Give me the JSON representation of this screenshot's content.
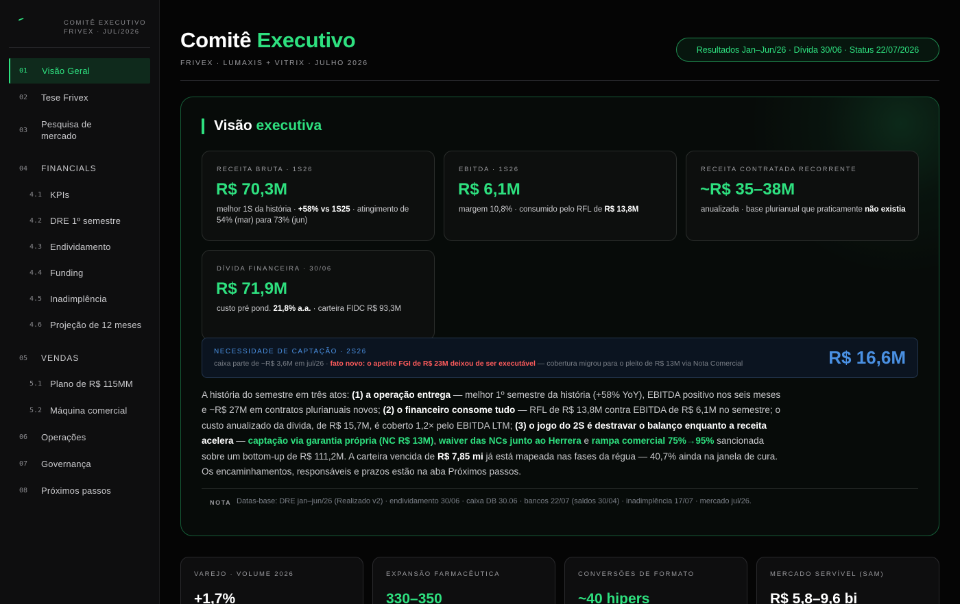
{
  "sidebar": {
    "brand_line1": "COMITÊ EXECUTIVO",
    "brand_line2": "FRIVEX · JUL/2026",
    "items": [
      {
        "num": "01",
        "label": "Visão Geral"
      },
      {
        "num": "02",
        "label": "Tese Frivex"
      },
      {
        "num": "03",
        "label": "Pesquisa de mercado"
      },
      {
        "num": "04",
        "label": "FINANCIALS"
      },
      {
        "num": "4.1",
        "label": "KPIs"
      },
      {
        "num": "4.2",
        "label": "DRE 1º semestre"
      },
      {
        "num": "4.3",
        "label": "Endividamento"
      },
      {
        "num": "4.4",
        "label": "Funding"
      },
      {
        "num": "4.5",
        "label": "Inadimplência"
      },
      {
        "num": "4.6",
        "label": "Projeção de 12 meses"
      },
      {
        "num": "05",
        "label": "VENDAS"
      },
      {
        "num": "5.1",
        "label": "Plano de R$ 115MM"
      },
      {
        "num": "5.2",
        "label": "Máquina comercial"
      },
      {
        "num": "06",
        "label": "Operações"
      },
      {
        "num": "07",
        "label": "Governança"
      },
      {
        "num": "08",
        "label": "Próximos passos"
      }
    ]
  },
  "header": {
    "title_main": "Comitê",
    "title_accent": "Executivo",
    "subtitle": "FRIVEX · LUMAXIS + VITRIX · JULHO 2026",
    "pill": "Resultados Jan–Jun/26 · Dívida 30/06 · Status 22/07/2026"
  },
  "overview": {
    "title_main": "Visão",
    "title_accent": "executiva",
    "kpis": [
      {
        "label": "RECEITA BRUTA · 1S26",
        "value": "R$ 70,3M",
        "desc_a": "melhor 1S da história · ",
        "desc_b": "+58% vs 1S25",
        "desc_c": " · atingimento de 54% (mar) para 73% (jun)"
      },
      {
        "label": "EBITDA · 1S26",
        "value": "R$ 6,1M",
        "desc_a": "margem 10,8% · consumido pelo RFL de ",
        "desc_b": "R$ 13,8M",
        "desc_c": ""
      },
      {
        "label": "RECEITA CONTRATADA RECORRENTE",
        "value": "~R$ 35–38M",
        "desc_a": "anualizada · base plurianual que praticamente ",
        "desc_b": "não existia",
        "desc_c": ""
      },
      {
        "label": "DÍVIDA FINANCEIRA · 30/06",
        "value": "R$ 71,9M",
        "desc_a": "custo pré pond. ",
        "desc_b": "21,8% a.a.",
        "desc_c": " · carteira FIDC R$ 93,3M"
      }
    ],
    "need": {
      "label": "NECESSIDADE DE CAPTAÇÃO · 2S26",
      "desc_a": "caixa parte de −R$ 3,6M em jul/26 · ",
      "desc_warn": "fato novo: o apetite FGI de R$ 23M deixou de ser executável",
      "desc_b": " — cobertura migrou para o pleito de R$ 13M via Nota Comercial",
      "value": "R$ 16,6M"
    },
    "paragraph": {
      "p1": "A história do semestre em três atos: ",
      "b1": "(1) a operação entrega",
      "p2": " — melhor 1º semestre da história (+58% YoY), EBITDA positivo nos seis meses e ~R$ 27M em contratos plurianuais novos; ",
      "b2": "(2) o financeiro consome tudo",
      "p3": " — RFL de R$ 13,8M contra EBITDA de R$ 6,1M no semestre; o custo anualizado da dívida, de R$ 15,7M, é coberto 1,2× pelo EBITDA LTM; ",
      "b3": "(3) o jogo do 2S é destravar o balanço enquanto a receita acelera",
      "p4": " — ",
      "g1": "captação via garantia própria (NC R$ 13M)",
      "p5": ", ",
      "g2": "waiver das NCs junto ao Herrera",
      "p6": " e ",
      "g3": "rampa comercial 75%→95%",
      "p7": " sancionada sobre um bottom-up de R$ 111,2M. A carteira vencida de ",
      "b4": "R$ 7,85 mi",
      "p8": " já está mapeada nas fases da régua — 40,7% ainda na janela de cura. Os encaminhamentos, responsáveis e prazos estão na aba Próximos passos."
    },
    "note": {
      "tag": "NOTA",
      "text": "Datas-base: DRE jan–jun/26 (Realizado v2) · endividamento 30/06 · caixa DB 30.06 · bancos 22/07 (saldos 30/04) · inadimplência 17/07 · mercado jul/26."
    }
  },
  "bottom_cards": [
    {
      "label": "VAREJO · VOLUME 2026",
      "value": "+1,7%"
    },
    {
      "label": "EXPANSÃO FARMACÊUTICA",
      "value": "330–350"
    },
    {
      "label": "CONVERSÕES DE FORMATO",
      "value": "~40 hipers"
    },
    {
      "label": "MERCADO SERVÍVEL (SAM)",
      "value": "R$ 5,8–9,6 bi"
    }
  ],
  "colors": {
    "accent_green": "#2ee07f",
    "accent_blue": "#4a90e2",
    "warning_red": "#ff5c5c",
    "background": "#050505"
  }
}
